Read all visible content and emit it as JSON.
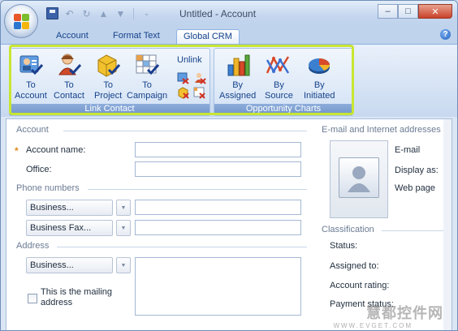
{
  "window": {
    "title": "Untitled - Account"
  },
  "tabs": [
    {
      "label": "Account",
      "active": false
    },
    {
      "label": "Format Text",
      "active": false
    },
    {
      "label": "Global CRM",
      "active": true
    }
  ],
  "ribbon": {
    "link_contact": {
      "label": "Link Contact",
      "buttons": [
        {
          "line1": "To",
          "line2": "Account",
          "icon": "account-card-icon"
        },
        {
          "line1": "To",
          "line2": "Contact",
          "icon": "contact-person-icon"
        },
        {
          "line1": "To",
          "line2": "Project",
          "icon": "project-cube-icon"
        },
        {
          "line1": "To",
          "line2": "Campaign",
          "icon": "campaign-grid-icon"
        }
      ],
      "unlink_label": "Unlink"
    },
    "opportunity_charts": {
      "label": "Opportunity Charts",
      "buttons": [
        {
          "line1": "By",
          "line2": "Assigned",
          "icon": "bar-chart-icon"
        },
        {
          "line1": "By",
          "line2": "Source",
          "icon": "line-chart-icon"
        },
        {
          "line1": "By",
          "line2": "Initiated",
          "icon": "pie-chart-icon"
        }
      ]
    }
  },
  "form": {
    "account_section": "Account",
    "account_name_label": "Account name:",
    "office_label": "Office:",
    "phone_section": "Phone numbers",
    "phone1_type": "Business...",
    "phone2_type": "Business Fax...",
    "address_section": "Address",
    "address_type": "Business...",
    "mailing_label": "This is the mailing address",
    "email_section": "E-mail and Internet addresses",
    "email_label": "E-mail",
    "display_label": "Display as:",
    "webpage_label": "Web page",
    "classification_section": "Classification",
    "status_label": "Status:",
    "assigned_label": "Assigned to:",
    "rating_label": "Account rating:",
    "payment_label": "Payment status:"
  },
  "watermark": {
    "text": "慧都控件网",
    "sub": "WWW.EVGET.COM"
  }
}
